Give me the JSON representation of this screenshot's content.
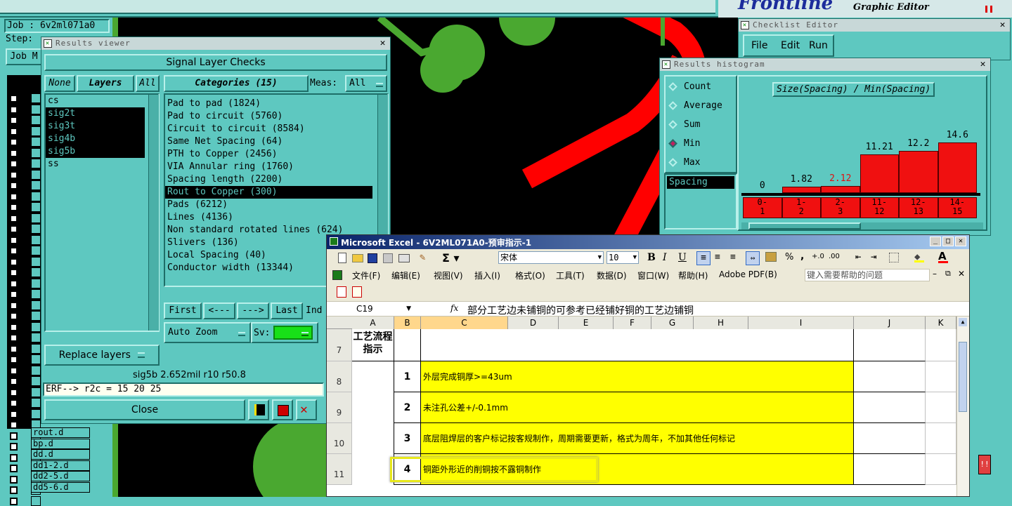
{
  "top": {
    "job_label": "Job : 6v2ml071a0",
    "step_label": "Step:",
    "job_button": "Job M",
    "graphic_editor": "Graphic Editor",
    "brand": "Frontline",
    "layer_tail": [
      "rout.d",
      "bp.d",
      "dd.d",
      "dd1-2.d",
      "dd2-5.d",
      "dd5-6.d"
    ]
  },
  "results_viewer": {
    "title": "Results viewer",
    "header": "Signal Layer Checks",
    "none_btn": "None",
    "layers_btn": "Layers",
    "all_btn": "All",
    "layers": [
      {
        "name": "cs",
        "selected": false
      },
      {
        "name": "sig2t",
        "selected": true
      },
      {
        "name": "sig3t",
        "selected": true
      },
      {
        "name": "sig4b",
        "selected": true
      },
      {
        "name": "sig5b",
        "selected": true
      },
      {
        "name": "ss",
        "selected": false
      }
    ],
    "categories_label": "Categories (15)",
    "meas_label": "Meas:",
    "meas_value": "All",
    "categories": [
      {
        "name": "Pad to pad (1824)",
        "selected": false
      },
      {
        "name": "Pad to circuit (5760)",
        "selected": false
      },
      {
        "name": "Circuit to circuit (8584)",
        "selected": false
      },
      {
        "name": "Same Net Spacing (64)",
        "selected": false
      },
      {
        "name": "PTH to Copper (2456)",
        "selected": false
      },
      {
        "name": "VIA Annular ring (1760)",
        "selected": false
      },
      {
        "name": "Spacing length (2200)",
        "selected": false
      },
      {
        "name": "Rout to Copper (300)",
        "selected": true
      },
      {
        "name": "Pads (6212)",
        "selected": false
      },
      {
        "name": "Lines (4136)",
        "selected": false
      },
      {
        "name": "Non standard rotated lines (624)",
        "selected": false
      },
      {
        "name": "Slivers (136)",
        "selected": false
      },
      {
        "name": "Local Spacing (40)",
        "selected": false
      },
      {
        "name": "Conductor width (13344)",
        "selected": false
      }
    ],
    "first_btn": "First",
    "prev_btn": "<---",
    "next_btn": "--->",
    "last_btn": "Last",
    "ind_label": "Ind",
    "auto_zoom": "Auto Zoom",
    "sv_label": "Sv:",
    "replace_layers": "Replace layers",
    "status": "sig5b 2.652mil  r10  r50.8",
    "erf": "ERF--> r2c = 15 20 25",
    "close_btn": "Close"
  },
  "checklist_editor": {
    "title": "Checklist Editor",
    "menu": [
      "File",
      "Edit",
      "Run"
    ]
  },
  "histogram": {
    "title": "Results histogram",
    "options": [
      {
        "label": "Count",
        "selected": false
      },
      {
        "label": "Average",
        "selected": false
      },
      {
        "label": "Sum",
        "selected": false
      },
      {
        "label": "Min",
        "selected": true
      },
      {
        "label": "Max",
        "selected": false
      }
    ],
    "measure": "Spacing",
    "chart_title": "Size(Spacing) / Min(Spacing)",
    "bars": [
      {
        "range": "0-\n1",
        "value": "0",
        "fill": 0.0,
        "value_color": "#000000"
      },
      {
        "range": "1-\n2",
        "value": "1.82",
        "fill": 0.124,
        "value_color": "#000000"
      },
      {
        "range": "2-\n3",
        "value": "2.12",
        "fill": 0.145,
        "value_color": "#e01010"
      },
      {
        "range": "11-\n12",
        "value": "11.21",
        "fill": 0.768,
        "value_color": "#000000"
      },
      {
        "range": "12-\n13",
        "value": "12.2",
        "fill": 0.836,
        "value_color": "#000000"
      },
      {
        "range": "14-\n15",
        "value": "14.6",
        "fill": 1.0,
        "value_color": "#000000"
      }
    ]
  },
  "excel": {
    "title": "Microsoft Excel - 6V2ML071A0-预审指示-1",
    "font_name": "宋体",
    "font_size": "10",
    "menu": [
      "文件(F)",
      "编辑(E)",
      "视图(V)",
      "插入(I)",
      "格式(O)",
      "工具(T)",
      "数据(D)",
      "窗口(W)",
      "帮助(H)",
      "Adobe PDF(B)"
    ],
    "help_placeholder": "键入需要帮助的问题",
    "name_box": "C19",
    "fx": "fx",
    "formula": "部分工艺边未铺铜的可参考已经铺好铜的工艺边铺铜",
    "columns": [
      "A",
      "B",
      "C",
      "D",
      "E",
      "F",
      "G",
      "H",
      "I",
      "J",
      "K"
    ],
    "header_cell": "工艺流程\n指示",
    "rows": [
      {
        "row": "7",
        "num": "",
        "text": ""
      },
      {
        "row": "8",
        "num": "1",
        "text": "外层完成铜厚>=43um"
      },
      {
        "row": "9",
        "num": "2",
        "text": "未注孔公差+/-0.1mm"
      },
      {
        "row": "10",
        "num": "3",
        "text": "底层阻焊层的客户标记按客规制作，周期需要更新，格式为周年，不加其他任何标记"
      },
      {
        "row": "11",
        "num": "4",
        "text": "铜距外形近的削铜按不露铜制作"
      }
    ]
  }
}
